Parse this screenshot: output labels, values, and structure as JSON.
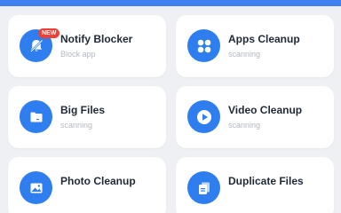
{
  "accent_color": "#2f7ef0",
  "cards": [
    {
      "title": "Notify Blocker",
      "subtitle": "Block app",
      "icon": "bell-off-icon",
      "badge": "NEW"
    },
    {
      "title": "Apps Cleanup",
      "subtitle": "scanning",
      "icon": "apps-grid-icon"
    },
    {
      "title": "Big Files",
      "subtitle": "scanning",
      "icon": "folder-icon"
    },
    {
      "title": "Video Cleanup",
      "subtitle": "scanning",
      "icon": "play-icon"
    },
    {
      "title": "Photo Cleanup",
      "subtitle": "",
      "icon": "image-icon"
    },
    {
      "title": "Duplicate Files",
      "subtitle": "",
      "icon": "duplicate-file-icon"
    }
  ]
}
